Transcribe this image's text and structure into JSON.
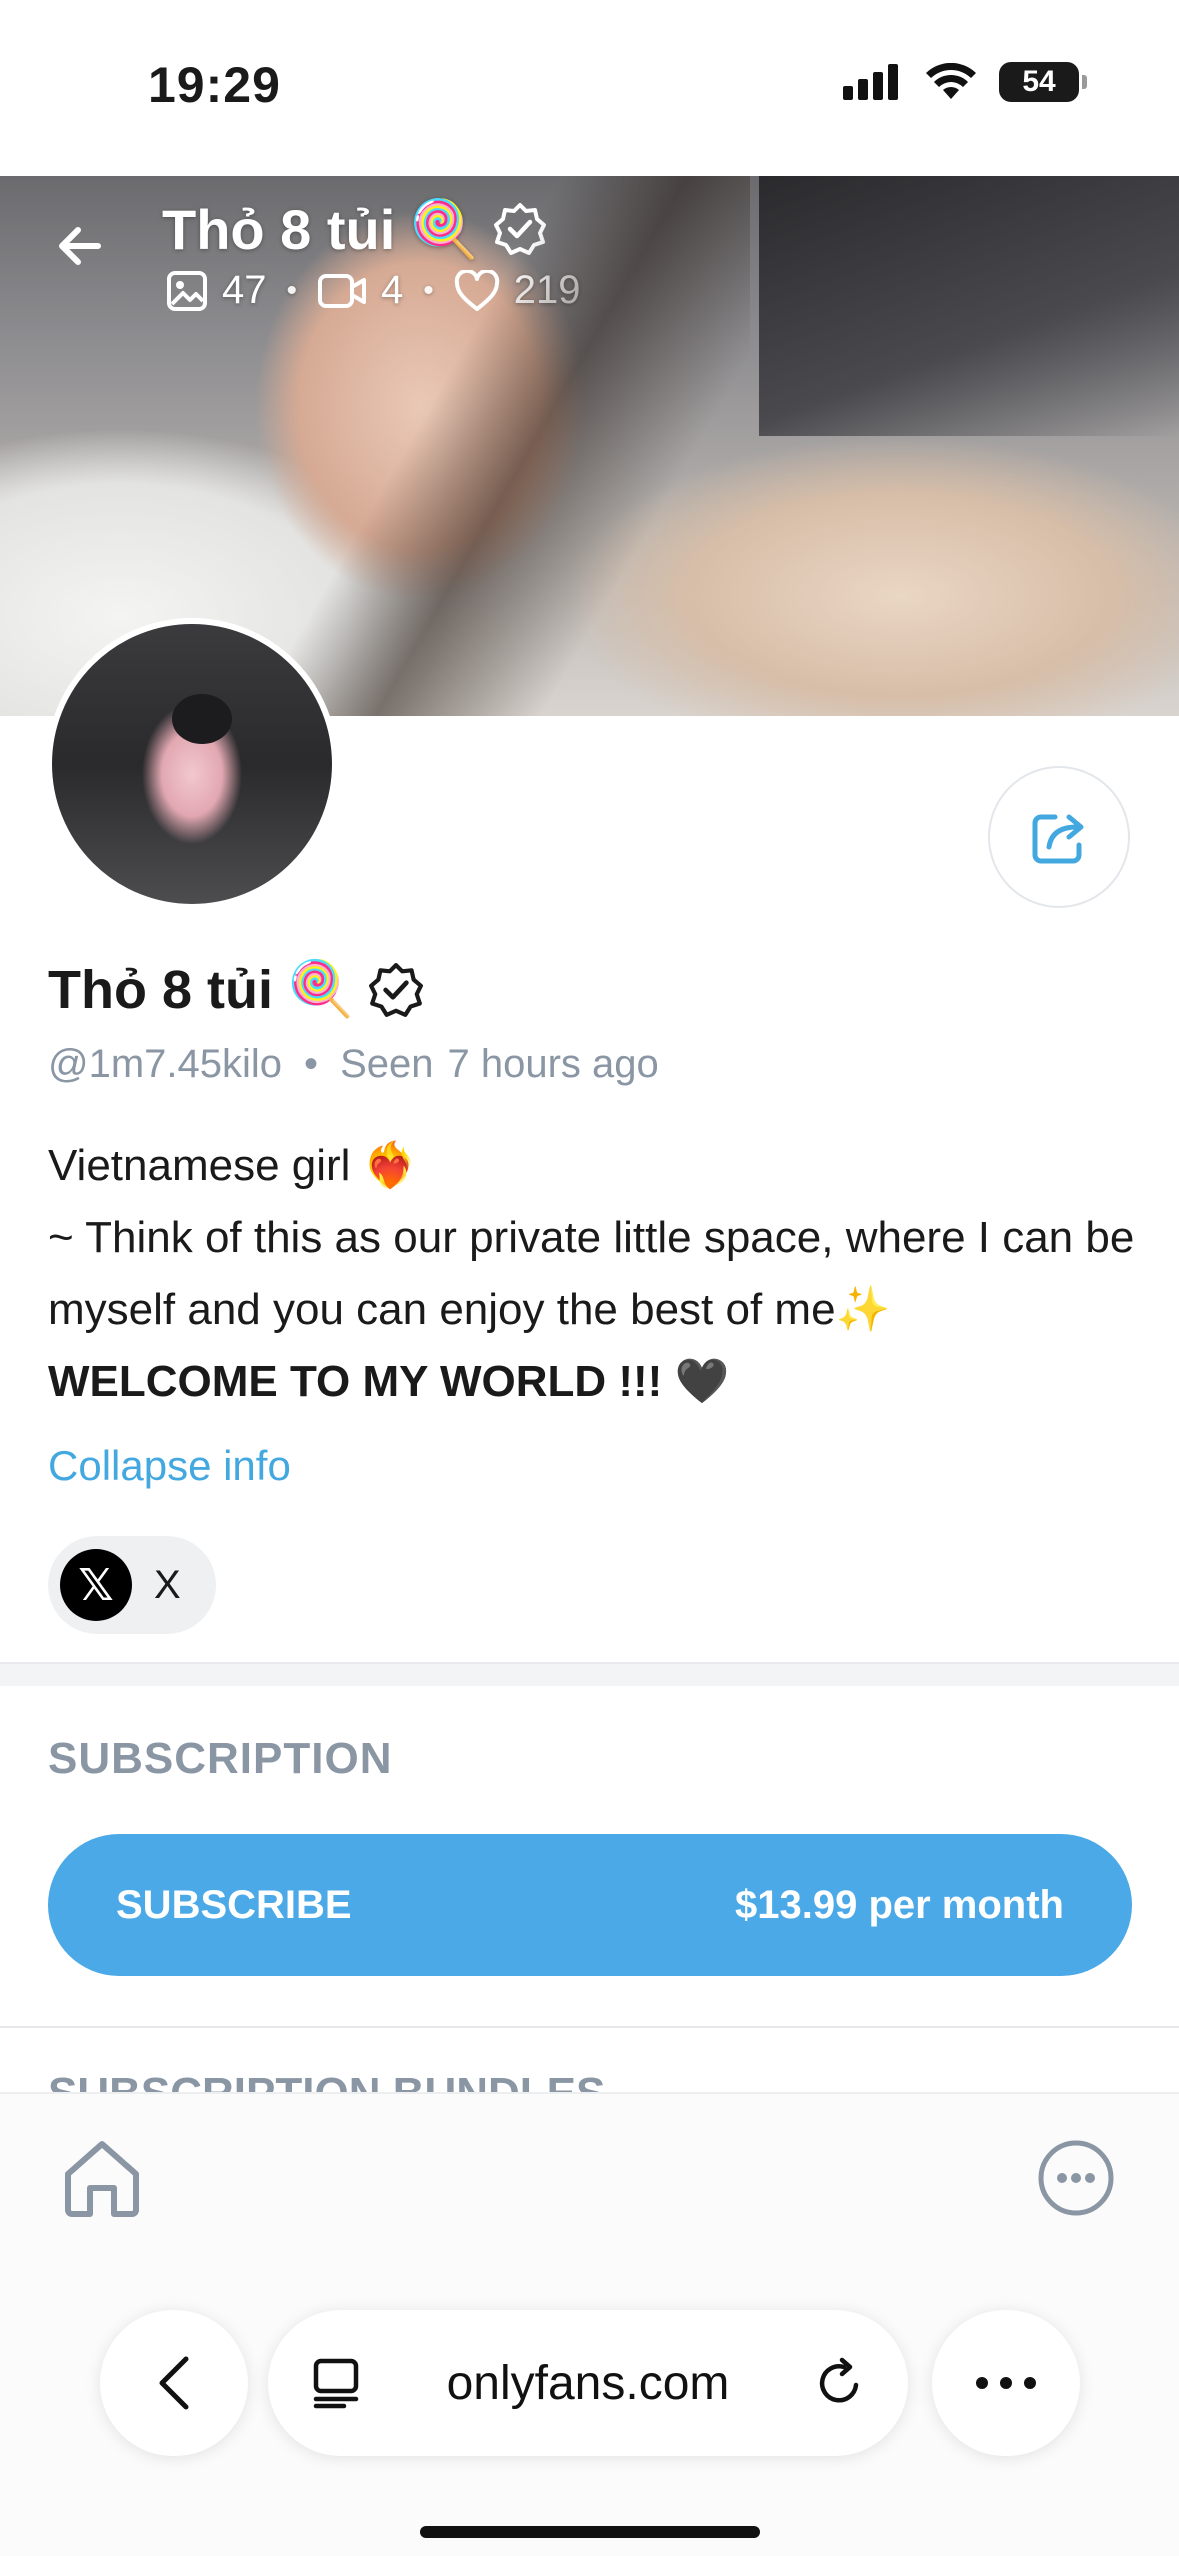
{
  "status_bar": {
    "time": "19:29",
    "battery": "54"
  },
  "cover": {
    "name": "Thỏ 8 tủi",
    "name_emoji": "🍭",
    "stats": {
      "photos": "47",
      "videos": "4",
      "likes": "219"
    }
  },
  "profile": {
    "name": "Thỏ 8 tủi",
    "name_emoji": "🍭",
    "handle": "@1m7.45kilo",
    "separator": "•",
    "seen_label": "Seen",
    "seen_time": "7 hours ago",
    "bio_line1": "Vietnamese girl ❤️‍🔥",
    "bio_line2": "~ Think of this as our private little space, where I can be myself and you can enjoy the best of me✨",
    "bio_line3": "WELCOME TO MY WORLD !!! 🖤",
    "collapse_label": "Collapse info",
    "social_x_label": "X"
  },
  "subscription": {
    "section_label": "SUBSCRIPTION",
    "button_label": "SUBSCRIBE",
    "price_label": "$13.99 per month",
    "bundles_label": "SUBSCRIPTION BUNDLES"
  },
  "browser": {
    "url": "onlyfans.com"
  },
  "colors": {
    "accent": "#4ba9e8",
    "link": "#44a8e0",
    "muted": "#8a96a3"
  },
  "icons": [
    "back-arrow-icon",
    "verified-icon",
    "image-icon",
    "video-icon",
    "heart-icon",
    "share-icon",
    "x-logo-icon",
    "home-icon",
    "more-icon",
    "tabs-icon",
    "reload-icon",
    "ellipsis-icon"
  ]
}
